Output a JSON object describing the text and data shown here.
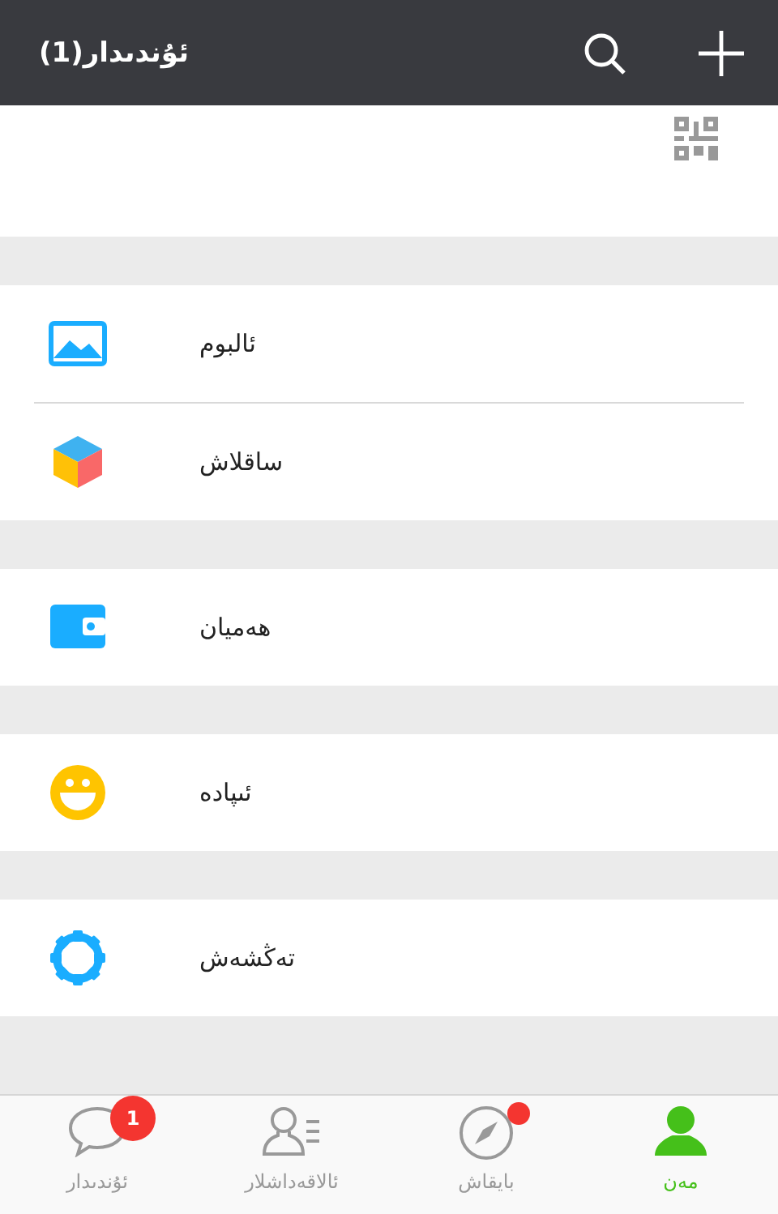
{
  "header": {
    "title": "ئۇندىدار(1)"
  },
  "groups": [
    {
      "items": [
        {
          "kind": "album",
          "label": "ئالبوم"
        },
        {
          "kind": "favorites",
          "label": "ساقلاش"
        }
      ]
    },
    {
      "items": [
        {
          "kind": "wallet",
          "label": "ھەميان"
        }
      ]
    },
    {
      "items": [
        {
          "kind": "emoji",
          "label": "ئىپادە"
        }
      ]
    },
    {
      "items": [
        {
          "kind": "settings",
          "label": "تەڭشەش"
        }
      ]
    }
  ],
  "tabs": [
    {
      "kind": "me",
      "label": "مەن",
      "selected": true,
      "dot": false
    },
    {
      "kind": "discover",
      "label": "بايقاش",
      "selected": false,
      "dot": true
    },
    {
      "kind": "contacts",
      "label": "ئالاقەداشلار",
      "selected": false,
      "dot": false
    },
    {
      "kind": "chats",
      "label": "ئۇندىدار",
      "selected": false,
      "badge": "1",
      "dot": false
    }
  ]
}
